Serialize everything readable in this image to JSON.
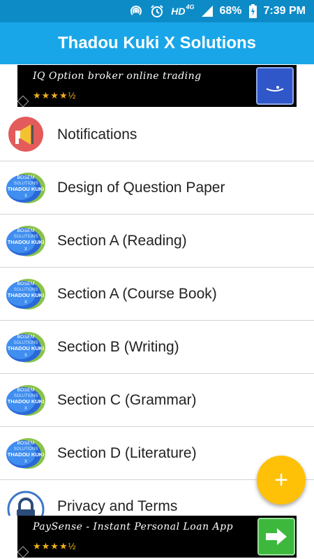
{
  "status_bar": {
    "network_type": "HD",
    "network_gen": "4G",
    "battery": "68%",
    "time": "7:39 PM"
  },
  "app_bar": {
    "title": "Thadou Kuki X Solutions"
  },
  "ads": {
    "top_text": "IQ Option broker online trading",
    "top_rating": "★★★★½",
    "bottom_text": "PaySense - Instant Personal Loan App",
    "bottom_rating": "★★★★½"
  },
  "logo": {
    "line1": "BOSEM",
    "line2": "SOLUTIONS",
    "line3": "THADOU KUKI",
    "line4": "X"
  },
  "menu": {
    "items": [
      {
        "label": "Notifications",
        "icon": "megaphone-icon"
      },
      {
        "label": "Design of Question Paper",
        "icon": "bosem-logo-icon"
      },
      {
        "label": "Section A (Reading)",
        "icon": "bosem-logo-icon"
      },
      {
        "label": "Section A (Course Book)",
        "icon": "bosem-logo-icon"
      },
      {
        "label": "Section B (Writing)",
        "icon": "bosem-logo-icon"
      },
      {
        "label": "Section C (Grammar)",
        "icon": "bosem-logo-icon"
      },
      {
        "label": "Section D (Literature)",
        "icon": "bosem-logo-icon"
      },
      {
        "label": "Privacy and Terms",
        "icon": "lock-icon"
      }
    ]
  },
  "fab": {
    "symbol": "+"
  },
  "colors": {
    "status_bar": "#0d8bc7",
    "app_bar": "#19a6e8",
    "fab": "#ffc107",
    "notification_circle": "#e35b5b"
  }
}
